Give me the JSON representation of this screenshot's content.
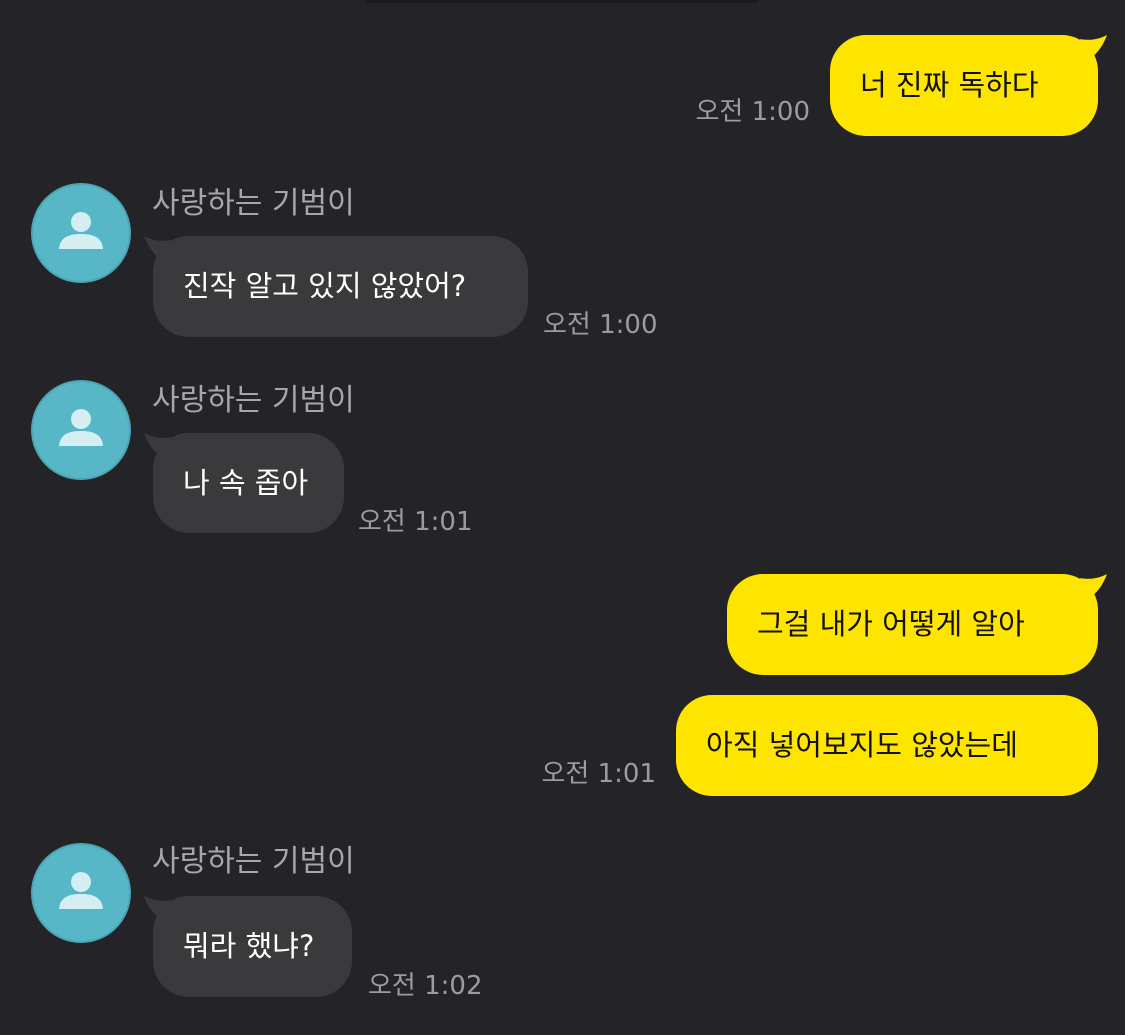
{
  "colors": {
    "background": "#242428",
    "my_bubble": "#fee500",
    "their_bubble": "#3a3a3d",
    "avatar": "#58b7c6",
    "timestamp": "#9c9c9f"
  },
  "messages": [
    {
      "side": "mine",
      "text": "너 진짜 독하다",
      "time": "오전 1:00"
    },
    {
      "side": "theirs",
      "sender": "사랑하는 기범이",
      "avatar_icon": "user-silhouette-icon",
      "text": "진작 알고 있지 않았어?",
      "time": "오전 1:00"
    },
    {
      "side": "theirs",
      "sender": "사랑하는 기범이",
      "avatar_icon": "user-silhouette-icon",
      "text": "나 속 좁아",
      "time": "오전 1:01"
    },
    {
      "side": "mine",
      "text": "그걸 내가 어떻게 알아",
      "time": ""
    },
    {
      "side": "mine",
      "text": "아직 넣어보지도 않았는데",
      "time": "오전 1:01"
    },
    {
      "side": "theirs",
      "sender": "사랑하는 기범이",
      "avatar_icon": "user-silhouette-icon",
      "text": "뭐라 했냐?",
      "time": "오전 1:02"
    }
  ]
}
